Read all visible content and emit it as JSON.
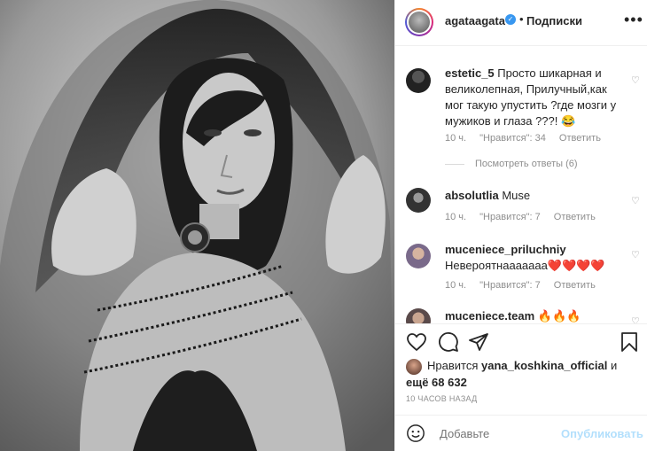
{
  "header": {
    "username": "agataagata",
    "dot": "•",
    "follow_label": "Подписки",
    "more": "•••"
  },
  "comments": [
    {
      "username": "estetic_5",
      "text": "Просто шикарная и великолепная, Прилучный,как мог такую упустить ?где мозги у мужиков и глаза ???! 😂",
      "time": "10 ч.",
      "likes": "\"Нравится\": 34",
      "reply": "Ответить",
      "view_replies": "Посмотреть ответы (6)"
    },
    {
      "username": "absolutlia",
      "text": "Muse",
      "time": "10 ч.",
      "likes": "\"Нравится\": 7",
      "reply": "Ответить"
    },
    {
      "username": "muceniece_priluchniy",
      "text": "Невероятнааааааа❤️❤️❤️❤️",
      "time": "10 ч.",
      "likes": "\"Нравится\": 7",
      "reply": "Ответить"
    },
    {
      "username": "muceniece.team",
      "text": "🔥🔥🔥"
    }
  ],
  "likes": {
    "prefix": "Нравится",
    "user": "yana_koshkina_official",
    "and": "и",
    "more": "ещё 68 632"
  },
  "timestamp": "10 ЧАСОВ НАЗАД",
  "add_comment": {
    "placeholder": "Добавьте",
    "post_label": "Опубликовать"
  },
  "colors": {
    "link_blue": "#3897f0",
    "post_disabled": "#b2dffc",
    "muted": "#8e8e8e"
  }
}
